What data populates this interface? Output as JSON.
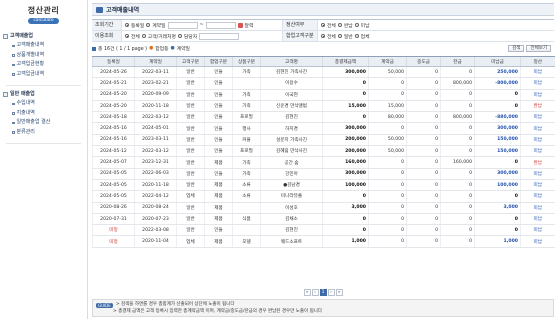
{
  "app": {
    "title": "정산관리",
    "subtitle": "calculate"
  },
  "sidebar": {
    "groups": [
      {
        "title": "고객매출업",
        "items": [
          "고객매출내역",
          "상품개별내역",
          "고객입금현황",
          "고객입금내역"
        ]
      },
      {
        "title": "일반 매출업",
        "items": [
          "수입내역",
          "지출내역",
          "일반매출업 결산",
          "분류관리"
        ]
      }
    ]
  },
  "page": {
    "title": "고객매출내역"
  },
  "search": {
    "period_label": "조회기간",
    "period_opts": [
      "등록일",
      "계약일"
    ],
    "calendar_label": "달력",
    "settle_label": "정산여부",
    "settle_opts": [
      "전체",
      "완납",
      "미납"
    ],
    "target_label": "이용조회",
    "target_opts": [
      "전체",
      "고객/거래처명",
      "담당자"
    ],
    "prog_label": "합업고객구분",
    "prog_opts": [
      "전체",
      "일반",
      "업체"
    ]
  },
  "toolbar": {
    "summary": "총 16건 ( 1 / 1 page )",
    "legend1": "합업등",
    "legend2": "계약일",
    "search_btn": "검색",
    "all_btn": "전체보기"
  },
  "table": {
    "headers": [
      "등록일",
      "계약일",
      "고객구분",
      "합업구분",
      "상품구분",
      "고객명",
      "총결제금액",
      "계약금",
      "중도금",
      "잔금",
      "미납금",
      "정산"
    ],
    "rows": [
      [
        "2024-05-26",
        "2022-03-11",
        "일반",
        "인들",
        "가족",
        "김현진 가족사진",
        "300,000",
        "50,000",
        "0",
        "0",
        "250,000",
        "미납"
      ],
      [
        "2024-05-21",
        "2023-02-21",
        "일반",
        "인들",
        "",
        "이용수",
        "0",
        "0",
        "0",
        "800,000",
        "-800,000",
        "미납"
      ],
      [
        "2024-05-20",
        "2020-09-09",
        "일반",
        "인들",
        "가족",
        "이국현",
        "0",
        "0",
        "0",
        "0",
        "0",
        "미납"
      ],
      [
        "2024-05-20",
        "2020-11-18",
        "일반",
        "인들",
        "가족",
        "신운경 만삭앨범",
        "15,000",
        "15,000",
        "0",
        "0",
        "0",
        "완납"
      ],
      [
        "2024-05-18",
        "2022-03-12",
        "일반",
        "인들",
        "프로필",
        "김현진",
        "0",
        "80,000",
        "0",
        "800,000",
        "-880,000",
        "미납"
      ],
      [
        "2024-05-16",
        "2024-05-01",
        "일반",
        "인들",
        "행사",
        "하지경",
        "300,000",
        "0",
        "0",
        "0",
        "300,000",
        "미납"
      ],
      [
        "2024-05-16",
        "2023-03-11",
        "일반",
        "인들",
        "커플",
        "설문지 가족사진",
        "200,000",
        "50,000",
        "0",
        "0",
        "150,000",
        "미납"
      ],
      [
        "2024-05-12",
        "2022-03-12",
        "일반",
        "인들",
        "프로필",
        "김혜림 만삭사진",
        "200,000",
        "50,000",
        "0",
        "0",
        "150,000",
        "미납"
      ],
      [
        "2024-05-07",
        "2023-12-31",
        "일반",
        "제품",
        "가족",
        "공간 숲",
        "160,000",
        "0",
        "0",
        "160,000",
        "0",
        "완납"
      ],
      [
        "2024-05-05",
        "2022-06-03",
        "일반",
        "인들",
        "가족",
        "강민아",
        "300,000",
        "0",
        "0",
        "0",
        "300,000",
        "미납"
      ],
      [
        "2024-05-05",
        "2020-11-18",
        "일반",
        "제품",
        "소류",
        "●김남경",
        "100,000",
        "0",
        "0",
        "0",
        "100,000",
        "미납"
      ],
      [
        "2024-05-05",
        "2022-04-12",
        "업체",
        "제품",
        "소류",
        "미나라뮤즐",
        "0",
        "0",
        "0",
        "0",
        "0",
        "미납"
      ],
      [
        "2020-08-26",
        "2020-08-24",
        "일반",
        "제품",
        "",
        "이성호",
        "3,000",
        "0",
        "0",
        "0",
        "3,000",
        "미납"
      ],
      [
        "2020-07-31",
        "2020-07-23",
        "일반",
        "제품",
        "식품",
        "김채소",
        "0",
        "0",
        "0",
        "0",
        "0",
        "미납"
      ],
      [
        "미정",
        "2022-03-08",
        "일반",
        "인들",
        "",
        "김현진",
        "0",
        "0",
        "0",
        "0",
        "0",
        "미납"
      ],
      [
        "미정",
        "2020-11-04",
        "업체",
        "제품",
        "모델",
        "웨드소프트",
        "1,000",
        "0",
        "0",
        "0",
        "1,000",
        "미납"
      ]
    ]
  },
  "pager": {
    "prev_first": "«",
    "prev": "‹",
    "current": "1",
    "next": "›",
    "next_last": "»"
  },
  "guide": {
    "tag": "GUIDE",
    "line1": "> 검색을 하면를 경우 총합계가 산출되어 상단에 노출이 됩니다",
    "line2": "> 총결제 금액은 고객 등록시 입력한 총계약금액 이며, 계약금/중도금/잔금의 경우 완납된 경우만 노출이 됩니다"
  }
}
